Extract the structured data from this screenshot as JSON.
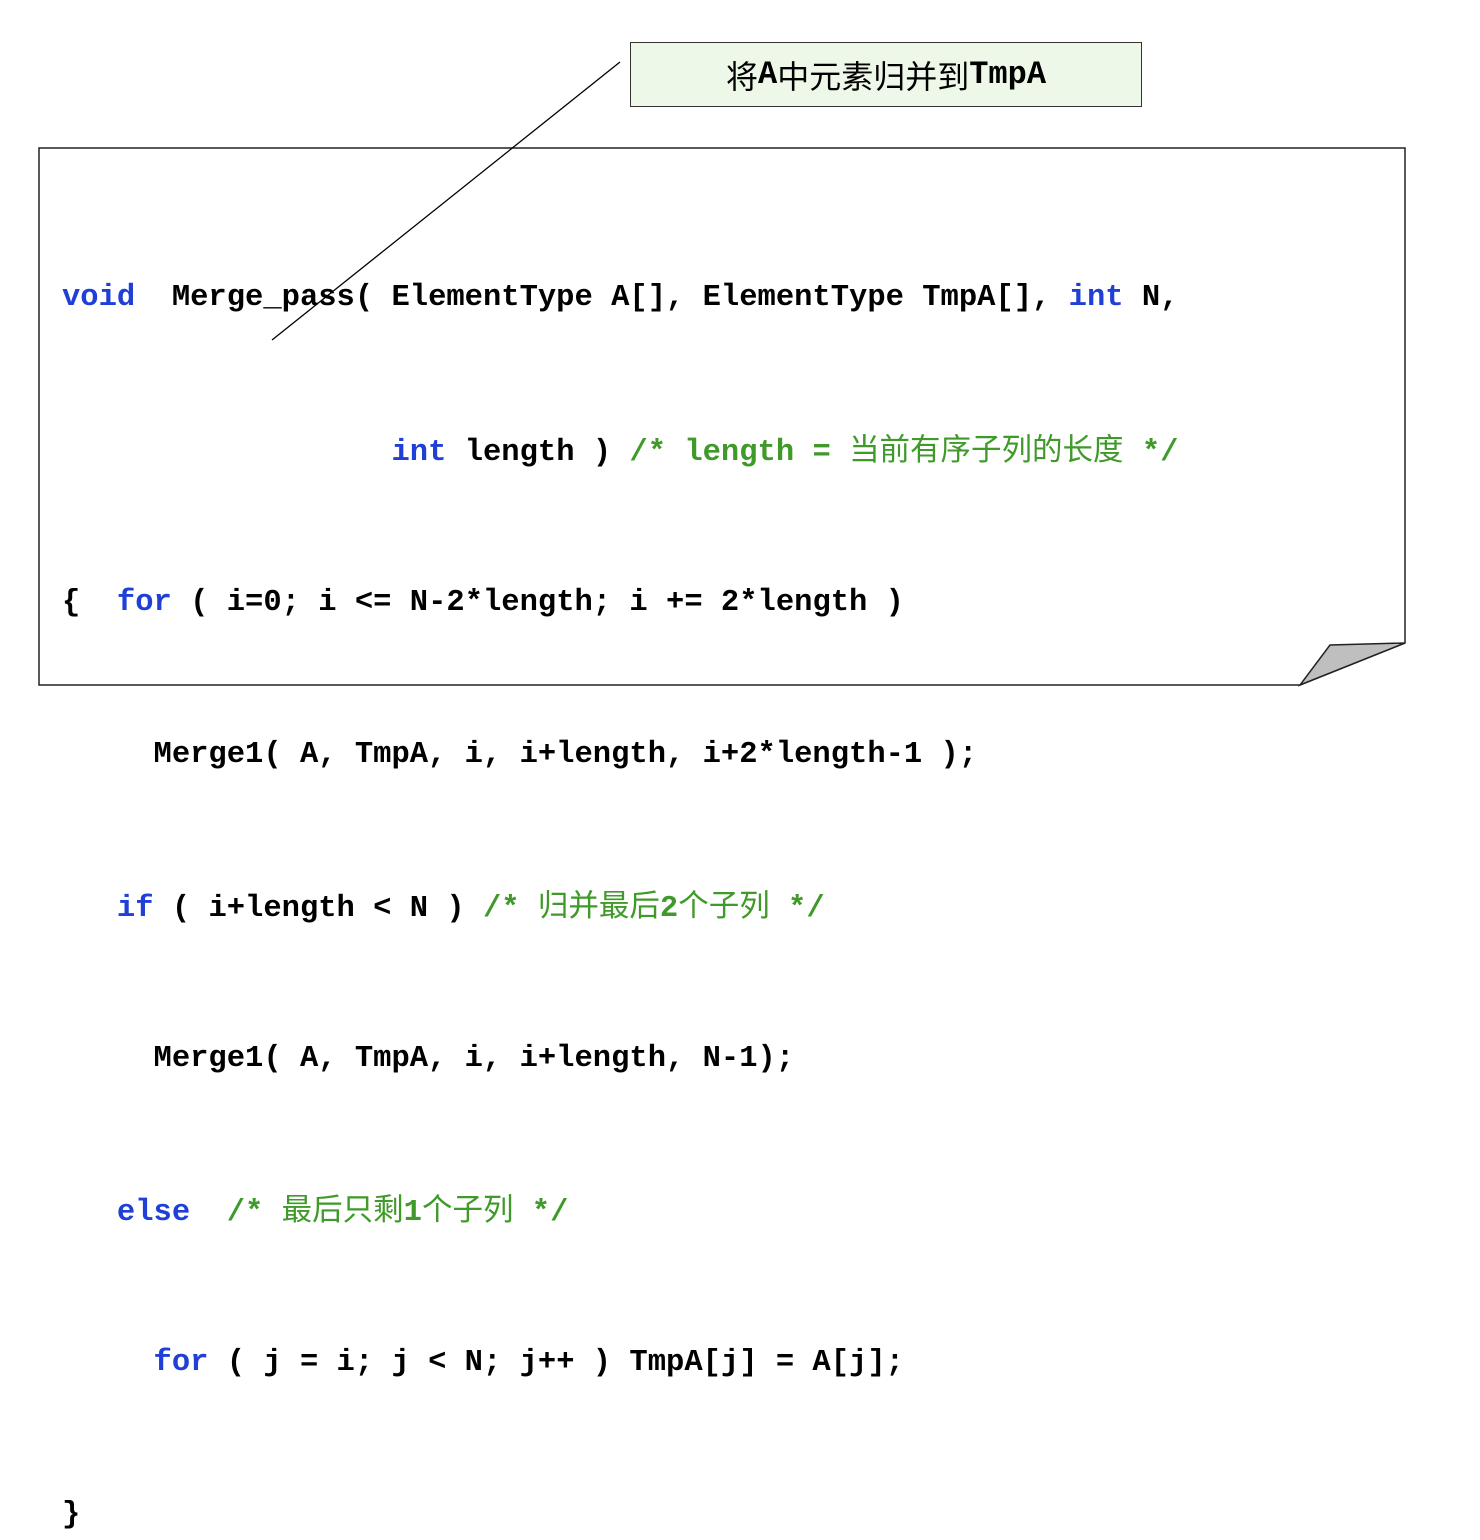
{
  "callout": {
    "prefix": "将",
    "var1": "A",
    "middle": "中元素归并到",
    "var2": "TmpA"
  },
  "code": {
    "l1": {
      "kw_void": "void",
      "sig": "  Merge_pass( ElementType A[], ElementType TmpA[], ",
      "kw_int": "int",
      "tail": " N,"
    },
    "l2": {
      "indent": "                  ",
      "kw_int": "int",
      "mid": " length ) ",
      "cm_start": "/* length = ",
      "cm_cjk": "当前有序子列的长度",
      "cm_end": " */"
    },
    "l3": {
      "brace": "{  ",
      "kw_for": "for",
      "rest": " ( i=0; i <= N-2*length; i += 2*length )"
    },
    "l4": {
      "text": "     Merge1( A, TmpA, i, i+length, i+2*length-1 );"
    },
    "l5": {
      "indent": "   ",
      "kw_if": "if",
      "mid": " ( i+length < N ) ",
      "cm_start": "/* ",
      "cm_cjk1": "归并最后",
      "cm_num": "2",
      "cm_cjk2": "个子列",
      "cm_end": " */"
    },
    "l6": {
      "text": "     Merge1( A, TmpA, i, i+length, N-1);"
    },
    "l7": {
      "indent": "   ",
      "kw_else": "else",
      "mid": "  ",
      "cm_start": "/* ",
      "cm_cjk1": "最后只剩",
      "cm_num": "1",
      "cm_cjk2": "个子列",
      "cm_end": " */"
    },
    "l8": {
      "indent": "     ",
      "kw_for": "for",
      "rest": " ( j = i; j < N; j++ ) TmpA[j] = A[j];"
    },
    "l9": {
      "brace": "}"
    }
  },
  "colors": {
    "keyword": "#1f3fd6",
    "comment": "#3f9a2a",
    "callout_bg": "#eef8e8"
  }
}
